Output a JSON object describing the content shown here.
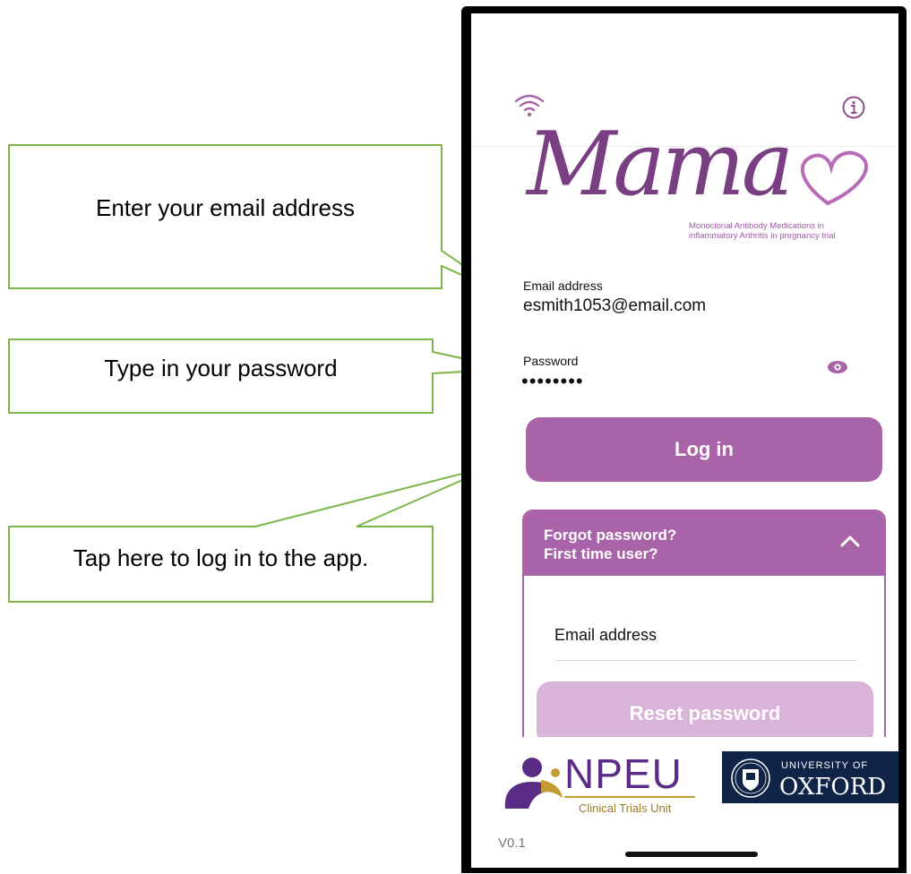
{
  "callouts": {
    "email": "Enter your email address",
    "password": "Type in your password",
    "login": "Tap here to log in to the app."
  },
  "app": {
    "logo_word": "Mama",
    "logo_subtitle_line1": "Monoclonal Antibody Medications in",
    "logo_subtitle_line2": "inflammatory Arthritis in pregnancy trial",
    "email_label": "Email address",
    "email_value": "esmith1053@email.com",
    "password_label": "Password",
    "password_value": "••••••••",
    "login_button": "Log in",
    "panel_title_line1": "Forgot password?",
    "panel_title_line2": "First time user?",
    "panel_email_placeholder": "Email address",
    "reset_button": "Reset password",
    "version": "V0.1"
  },
  "footer": {
    "npeu": "NPEU",
    "npeu_sub": "Clinical Trials Unit",
    "oxford_line1": "UNIVERSITY OF",
    "oxford_line2": "OXFORD"
  },
  "colors": {
    "brand_purple": "#a964a9",
    "reset_disabled": "#d9b3d9",
    "callout_border": "#7ab648",
    "oxford_blue": "#0f2446"
  }
}
